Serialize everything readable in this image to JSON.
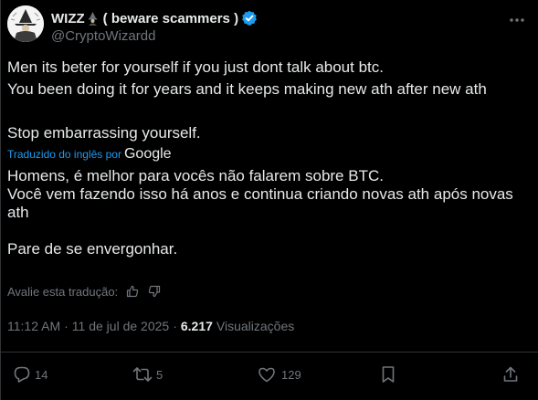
{
  "author": {
    "display_name": "WIZZ",
    "name_suffix": "( beware scammers )",
    "handle": "@CryptoWizardd",
    "avatar_icon": "wizard-avatar",
    "verified_color": "#1d9bf0"
  },
  "tweet": {
    "lines": [
      "Men its beter for yourself if you just dont talk about btc.",
      "You been doing it for years and it keeps making new ath after new ath",
      "Stop embarrassing yourself."
    ]
  },
  "translation": {
    "label": "Traduzido do inglês por",
    "provider": "Google",
    "paragraph1": "Homens, é melhor para vocês não falarem sobre BTC.",
    "paragraph2": "Você vem fazendo isso há anos e continua criando novas ath após novas ath",
    "paragraph3": "Pare de se envergonhar.",
    "rate_label": "Avalie esta tradução:"
  },
  "meta": {
    "time": "11:12 AM",
    "separator": "·",
    "date": "11 de jul de 2025",
    "views_count": "6.217",
    "views_label": "Visualizações"
  },
  "actions": {
    "replies": "14",
    "reposts": "5",
    "likes": "129"
  },
  "colors": {
    "background": "#000000",
    "text": "#e7e9ea",
    "muted": "#71767b",
    "link": "#1d9bf0",
    "border": "#2f3336"
  }
}
